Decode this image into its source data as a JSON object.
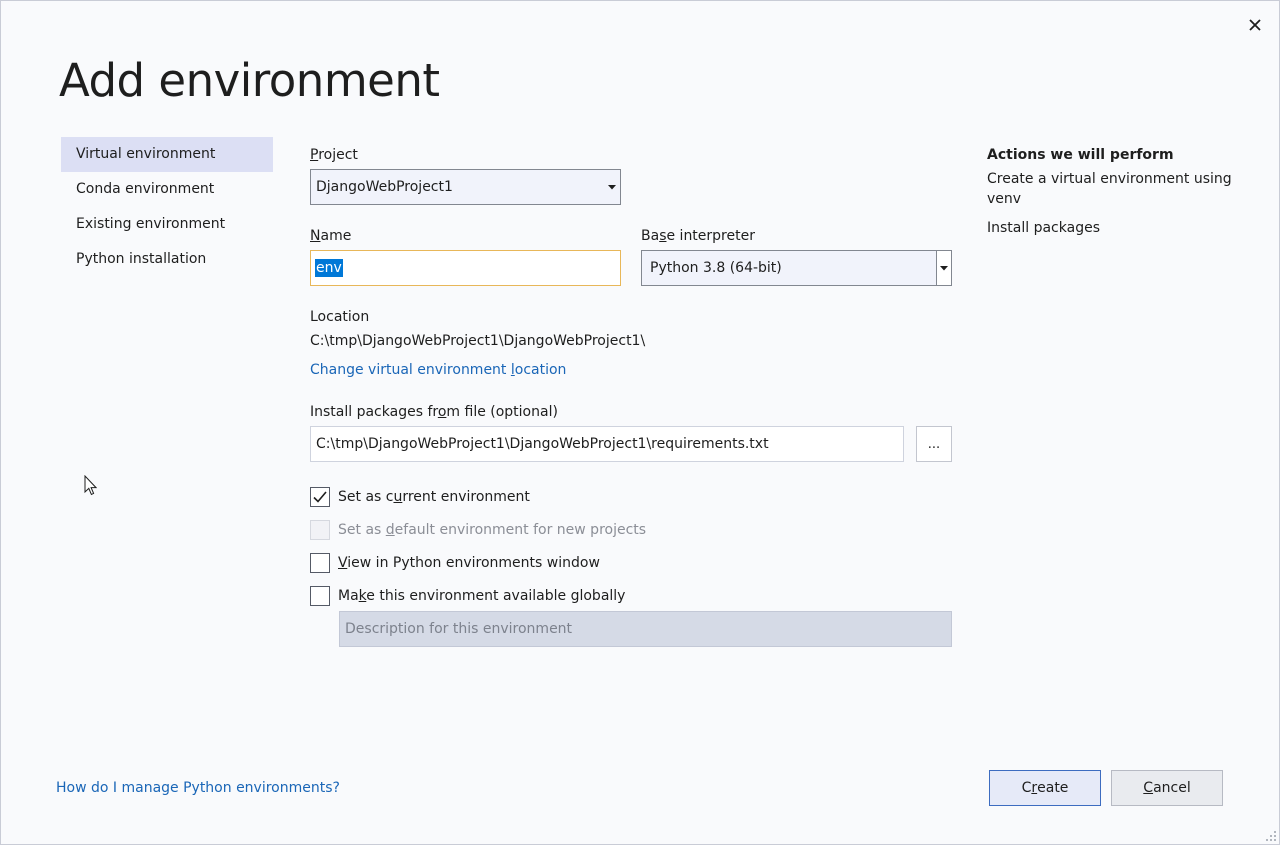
{
  "dialog": {
    "title": "Add environment",
    "close_label": "✕"
  },
  "nav": {
    "items": [
      {
        "label": "Virtual environment",
        "selected": true
      },
      {
        "label": "Conda environment",
        "selected": false
      },
      {
        "label": "Existing environment",
        "selected": false
      },
      {
        "label": "Python installation",
        "selected": false
      }
    ]
  },
  "form": {
    "project": {
      "label_first": "P",
      "label_rest": "roject",
      "value": "DjangoWebProject1"
    },
    "name": {
      "label_first": "N",
      "label_rest": "ame",
      "value": "env"
    },
    "base_interpreter": {
      "label_pre": "Ba",
      "label_u": "s",
      "label_post": "e interpreter",
      "value": "Python 3.8 (64-bit)"
    },
    "location": {
      "label": "Location",
      "value": "C:\\tmp\\DjangoWebProject1\\DjangoWebProject1\\",
      "change_link_pre": "Change virtual environment ",
      "change_link_u": "l",
      "change_link_post": "ocation"
    },
    "packages": {
      "label_pre": "Install packages fr",
      "label_u": "o",
      "label_post": "m file (optional)",
      "value": "C:\\tmp\\DjangoWebProject1\\DjangoWebProject1\\requirements.txt",
      "browse_label": "..."
    },
    "checks": {
      "set_current": {
        "pre": "Set as c",
        "u": "u",
        "post": "rrent environment",
        "checked": true
      },
      "set_default": {
        "pre": "Set as ",
        "u": "d",
        "post": "efault environment for new projects",
        "checked": false
      },
      "view_in_window": {
        "pre": "",
        "u": "V",
        "post": "iew in Python environments window",
        "checked": false
      },
      "make_global": {
        "pre": "Ma",
        "u": "k",
        "post": "e this environment available globally",
        "checked": false
      }
    },
    "description_placeholder": "Description for this environment"
  },
  "actions": {
    "heading": "Actions we will perform",
    "items": [
      "Create a virtual environment using venv",
      "Install packages"
    ]
  },
  "footer": {
    "help_link": "How do I manage Python environments?",
    "create_pre": "C",
    "create_u": "r",
    "create_post": "eate",
    "cancel_pre": "",
    "cancel_u": "C",
    "cancel_post": "ancel"
  },
  "colors": {
    "accent": "#0078d7",
    "link": "#1a66b7",
    "selected_nav": "#dcdff4",
    "focus_border": "#e8b759"
  }
}
